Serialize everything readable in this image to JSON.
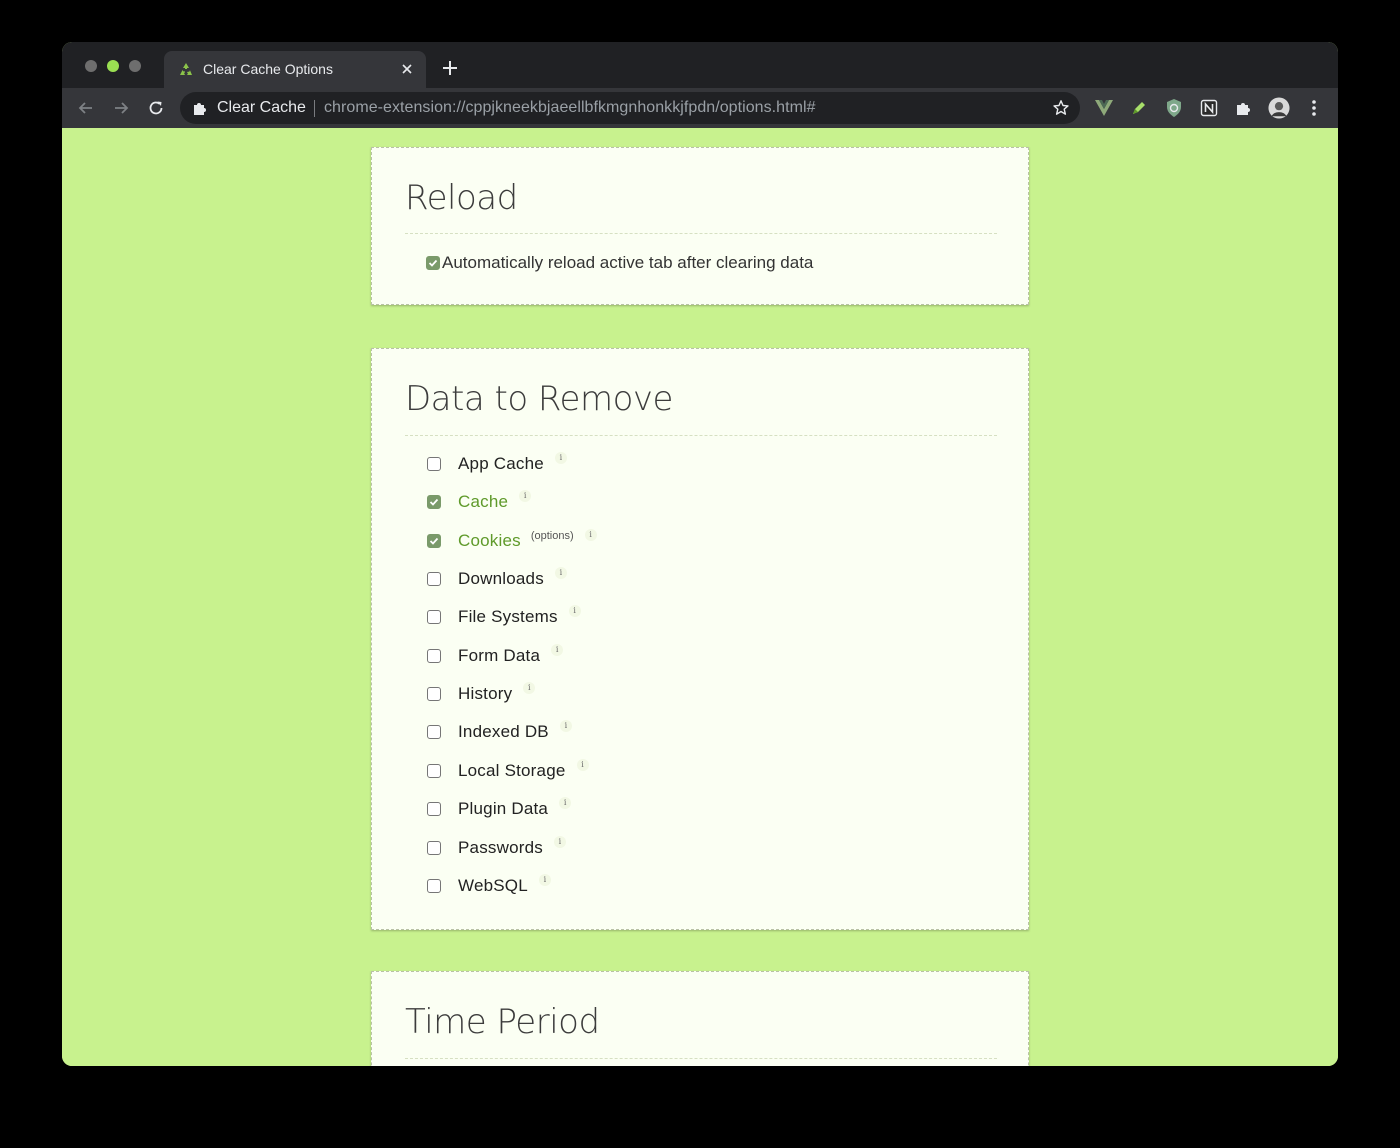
{
  "browser": {
    "tab_title": "Clear Cache Options",
    "new_tab_label": "+",
    "omnibox_origin": "Clear Cache",
    "omnibox_url": "chrome-extension://cppjkneekbjaeellbfkmgnhonkkjfpdn/options.html#",
    "extensions": [
      "vue-devtools-icon",
      "pen-icon",
      "shield-icon",
      "notion-icon",
      "extensions-puzzle-icon",
      "profile-avatar",
      "menu-kebab-icon"
    ]
  },
  "colors": {
    "page_bg": "#c8f28e",
    "card_bg": "#fbfff3",
    "checked_label": "#5f9a2a",
    "checkbox_checked": "#7a9a6a"
  },
  "reload_section": {
    "title": "Reload",
    "option": {
      "label": "Automatically reload active tab after clearing data",
      "checked": true
    }
  },
  "data_section": {
    "title": "Data to Remove",
    "info_glyph": "i",
    "options_note": "(options)",
    "items": [
      {
        "label": "App Cache",
        "checked": false
      },
      {
        "label": "Cache",
        "checked": true
      },
      {
        "label": "Cookies",
        "checked": true
      },
      {
        "label": "Downloads",
        "checked": false
      },
      {
        "label": "File Systems",
        "checked": false
      },
      {
        "label": "Form Data",
        "checked": false
      },
      {
        "label": "History",
        "checked": false
      },
      {
        "label": "Indexed DB",
        "checked": false
      },
      {
        "label": "Local Storage",
        "checked": false
      },
      {
        "label": "Plugin Data",
        "checked": false
      },
      {
        "label": "Passwords",
        "checked": false
      },
      {
        "label": "WebSQL",
        "checked": false
      }
    ]
  },
  "time_section": {
    "title": "Time Period"
  }
}
